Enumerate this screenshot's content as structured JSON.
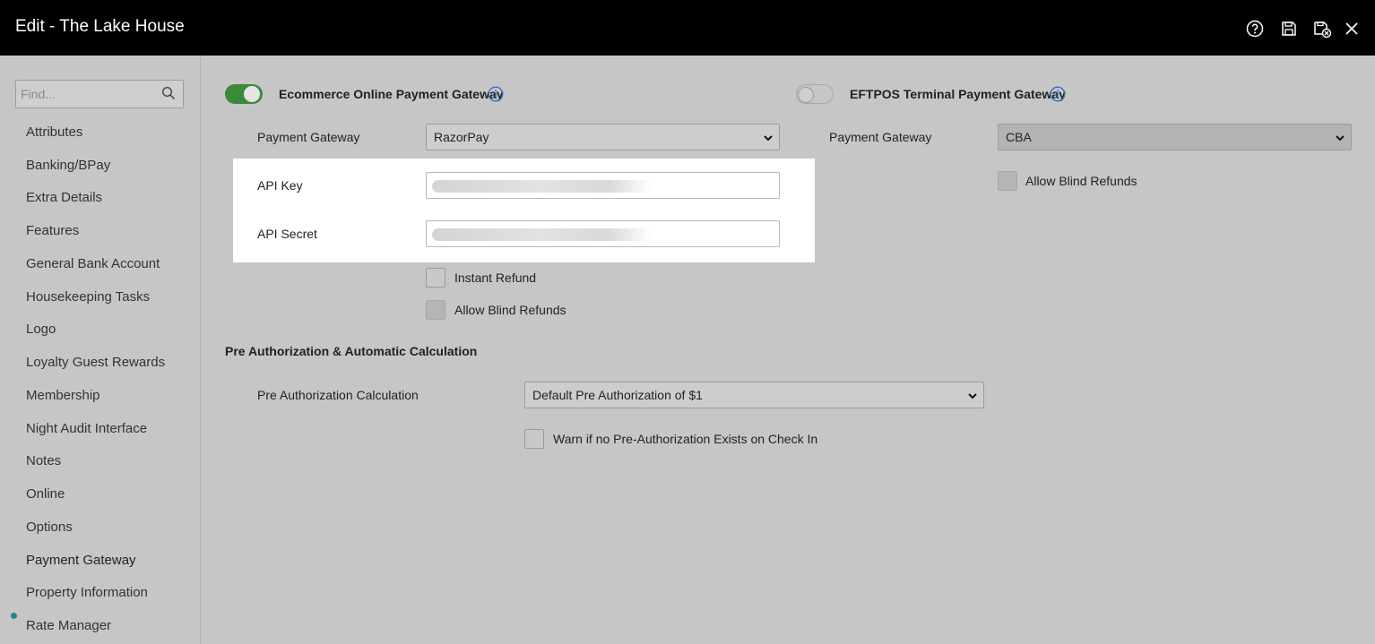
{
  "window": {
    "title": "Edit - The Lake House",
    "toolbar_icons": [
      "help-icon",
      "save-icon",
      "save-and-close-icon",
      "close-icon"
    ]
  },
  "sidebar": {
    "search_placeholder": "Find...",
    "items": [
      {
        "label": "Attributes"
      },
      {
        "label": "Banking/BPay"
      },
      {
        "label": "Extra Details"
      },
      {
        "label": "Features"
      },
      {
        "label": "General Bank Account"
      },
      {
        "label": "Housekeeping Tasks"
      },
      {
        "label": "Logo"
      },
      {
        "label": "Loyalty Guest Rewards"
      },
      {
        "label": "Membership"
      },
      {
        "label": "Night Audit Interface"
      },
      {
        "label": "Notes"
      },
      {
        "label": "Online"
      },
      {
        "label": "Options"
      },
      {
        "label": "Payment Gateway",
        "active": true
      },
      {
        "label": "Property Information"
      },
      {
        "label": "Rate Manager"
      }
    ]
  },
  "ecommerce": {
    "toggle_label": "Ecommerce Online Payment Gateway",
    "enabled": true,
    "gateway_label": "Payment Gateway",
    "gateway_value": "RazorPay",
    "api_key_label": "API Key",
    "api_secret_label": "API Secret",
    "instant_refund_label": "Instant Refund",
    "allow_blind_refunds_label": "Allow Blind Refunds"
  },
  "eftpos": {
    "toggle_label": "EFTPOS Terminal Payment Gateway",
    "enabled": false,
    "gateway_label": "Payment Gateway",
    "gateway_value": "CBA",
    "allow_blind_refunds_label": "Allow Blind Refunds"
  },
  "preauth": {
    "section_title": "Pre Authorization & Automatic Calculation",
    "calc_label": "Pre Authorization Calculation",
    "calc_value": "Default Pre Authorization of $1",
    "warn_label": "Warn if no Pre-Authorization Exists on Check In"
  },
  "colors": {
    "accent_green": "#3b8a3b",
    "info_blue": "#2c6fd1",
    "active_dot": "#1c8a8c"
  }
}
